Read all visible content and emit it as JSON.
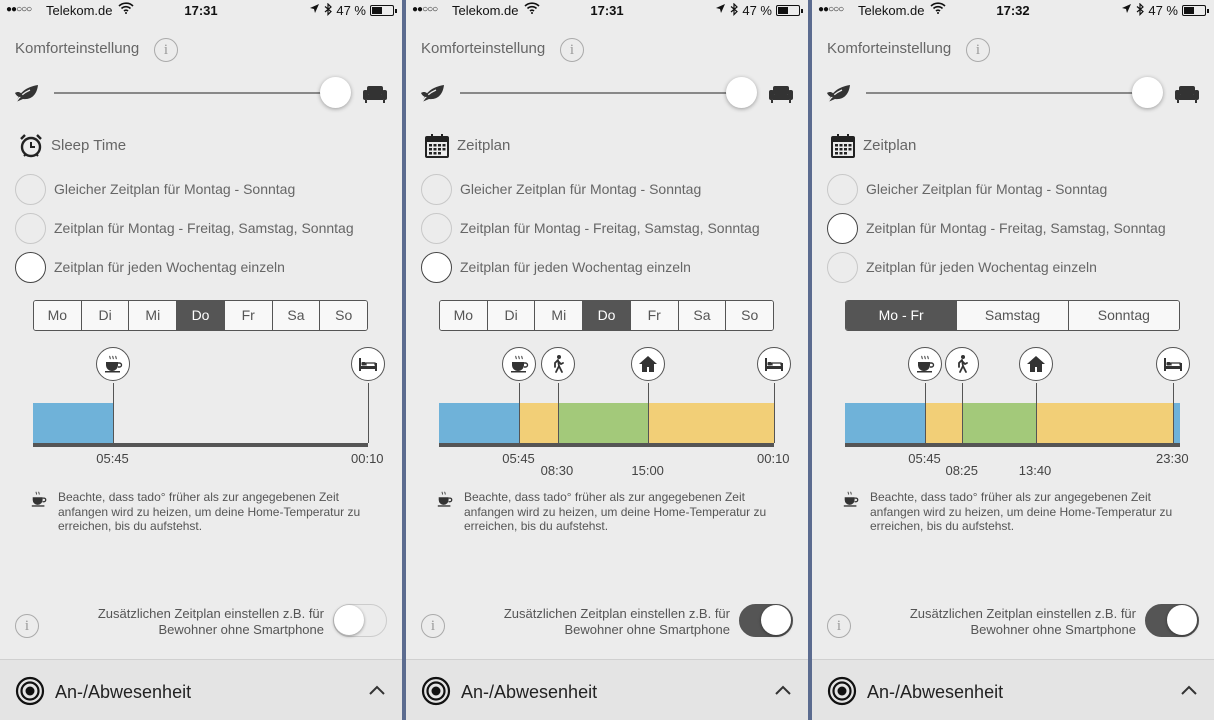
{
  "colors": {
    "sleep": "#6fb2d9",
    "morning": "#f2cf77",
    "away": "#a3c97a",
    "evening": "#f2cf77",
    "dark": "#555555"
  },
  "panels": [
    {
      "status": {
        "signal": "●●○○○",
        "carrier": "Telekom.de",
        "time": "17:31",
        "battery": "47 %"
      },
      "comfort_label": "Komforteinstellung",
      "comfort_level": 1.0,
      "section_icon": "alarm-clock-icon",
      "section_title": "Sleep Time",
      "radios": [
        {
          "label": "Gleicher Zeitplan für Montag - Sonntag",
          "selected": false
        },
        {
          "label": "Zeitplan für Montag - Freitag, Samstag, Sonntag",
          "selected": false
        },
        {
          "label": "Zeitplan für jeden Wochentag einzeln",
          "selected": true
        }
      ],
      "days": [
        {
          "label": "Mo",
          "active": false
        },
        {
          "label": "Di",
          "active": false
        },
        {
          "label": "Mi",
          "active": false
        },
        {
          "label": "Do",
          "active": true
        },
        {
          "label": "Fr",
          "active": false
        },
        {
          "label": "Sa",
          "active": false
        },
        {
          "label": "So",
          "active": false
        }
      ],
      "timeline": {
        "segments": [
          {
            "from": "00:00",
            "to": "05:45",
            "kind": "sleep"
          },
          {
            "from": "00:10",
            "to": "24:00",
            "kind": "sleep"
          }
        ],
        "pins": [
          {
            "time": "05:45",
            "icon": "coffee-cup-icon"
          },
          {
            "time": "00:10",
            "icon": "bed-icon"
          }
        ],
        "labels": [
          {
            "text": "05:45",
            "time": "05:45",
            "row": 0
          },
          {
            "text": "00:10",
            "time": "00:10",
            "row": 0
          }
        ]
      },
      "note": "Beachte, dass tado° früher als zur angegebenen Zeit anfangen wird zu heizen, um deine Home-Temperatur zu erreichen, bis du aufstehst.",
      "extra_label": "Zusätzlichen Zeitplan einstellen z.B. für Bewohner ohne Smartphone",
      "extra_on": false,
      "footer_title": "An-/Abwesenheit"
    },
    {
      "status": {
        "signal": "●●○○○",
        "carrier": "Telekom.de",
        "time": "17:31",
        "battery": "47 %"
      },
      "comfort_label": "Komforteinstellung",
      "comfort_level": 1.0,
      "section_icon": "calendar-icon",
      "section_title": "Zeitplan",
      "radios": [
        {
          "label": "Gleicher Zeitplan für Montag - Sonntag",
          "selected": false
        },
        {
          "label": "Zeitplan für Montag - Freitag, Samstag, Sonntag",
          "selected": false
        },
        {
          "label": "Zeitplan für jeden Wochentag einzeln",
          "selected": true
        }
      ],
      "days": [
        {
          "label": "Mo",
          "active": false
        },
        {
          "label": "Di",
          "active": false
        },
        {
          "label": "Mi",
          "active": false
        },
        {
          "label": "Do",
          "active": true
        },
        {
          "label": "Fr",
          "active": false
        },
        {
          "label": "Sa",
          "active": false
        },
        {
          "label": "So",
          "active": false
        }
      ],
      "timeline": {
        "segments": [
          {
            "from": "00:00",
            "to": "05:45",
            "kind": "sleep"
          },
          {
            "from": "05:45",
            "to": "08:30",
            "kind": "morning"
          },
          {
            "from": "08:30",
            "to": "15:00",
            "kind": "away"
          },
          {
            "from": "15:00",
            "to": "00:10",
            "kind": "evening"
          },
          {
            "from": "00:10",
            "to": "24:00",
            "kind": "sleep"
          }
        ],
        "pins": [
          {
            "time": "05:45",
            "icon": "coffee-cup-icon"
          },
          {
            "time": "08:30",
            "icon": "walking-person-icon"
          },
          {
            "time": "15:00",
            "icon": "home-icon"
          },
          {
            "time": "00:10",
            "icon": "bed-icon"
          }
        ],
        "labels": [
          {
            "text": "05:45",
            "time": "05:45",
            "row": 0
          },
          {
            "text": "08:30",
            "time": "08:30",
            "row": 1
          },
          {
            "text": "15:00",
            "time": "15:00",
            "row": 1
          },
          {
            "text": "00:10",
            "time": "00:10",
            "row": 0
          }
        ]
      },
      "note": "Beachte, dass tado° früher als zur angegebenen Zeit anfangen wird zu heizen, um deine Home-Temperatur zu erreichen, bis du aufstehst.",
      "extra_label": "Zusätzlichen Zeitplan einstellen z.B. für Bewohner ohne Smartphone",
      "extra_on": true,
      "footer_title": "An-/Abwesenheit"
    },
    {
      "status": {
        "signal": "●●○○○",
        "carrier": "Telekom.de",
        "time": "17:32",
        "battery": "47 %"
      },
      "comfort_label": "Komforteinstellung",
      "comfort_level": 1.0,
      "section_icon": "calendar-icon",
      "section_title": "Zeitplan",
      "radios": [
        {
          "label": "Gleicher Zeitplan für Montag - Sonntag",
          "selected": false
        },
        {
          "label": "Zeitplan für Montag - Freitag, Samstag, Sonntag",
          "selected": true
        },
        {
          "label": "Zeitplan für jeden Wochentag einzeln",
          "selected": false
        }
      ],
      "days": [
        {
          "label": "Mo - Fr",
          "active": true
        },
        {
          "label": "Samstag",
          "active": false
        },
        {
          "label": "Sonntag",
          "active": false
        }
      ],
      "timeline": {
        "segments": [
          {
            "from": "00:00",
            "to": "05:45",
            "kind": "sleep"
          },
          {
            "from": "05:45",
            "to": "08:25",
            "kind": "morning"
          },
          {
            "from": "08:25",
            "to": "13:40",
            "kind": "away"
          },
          {
            "from": "13:40",
            "to": "23:30",
            "kind": "evening"
          },
          {
            "from": "23:30",
            "to": "24:00",
            "kind": "sleep"
          }
        ],
        "pins": [
          {
            "time": "05:45",
            "icon": "coffee-cup-icon"
          },
          {
            "time": "08:25",
            "icon": "walking-person-icon"
          },
          {
            "time": "13:40",
            "icon": "home-icon"
          },
          {
            "time": "23:30",
            "icon": "bed-icon"
          }
        ],
        "labels": [
          {
            "text": "05:45",
            "time": "05:45",
            "row": 0
          },
          {
            "text": "08:25",
            "time": "08:25",
            "row": 1
          },
          {
            "text": "13:40",
            "time": "13:40",
            "row": 1
          },
          {
            "text": "23:30",
            "time": "23:30",
            "row": 0
          }
        ]
      },
      "note": "Beachte, dass tado° früher als zur angegebenen Zeit anfangen wird zu heizen, um deine Home-Temperatur zu erreichen, bis du aufstehst.",
      "extra_label": "Zusätzlichen Zeitplan einstellen z.B. für Bewohner ohne Smartphone",
      "extra_on": true,
      "footer_title": "An-/Abwesenheit"
    }
  ]
}
